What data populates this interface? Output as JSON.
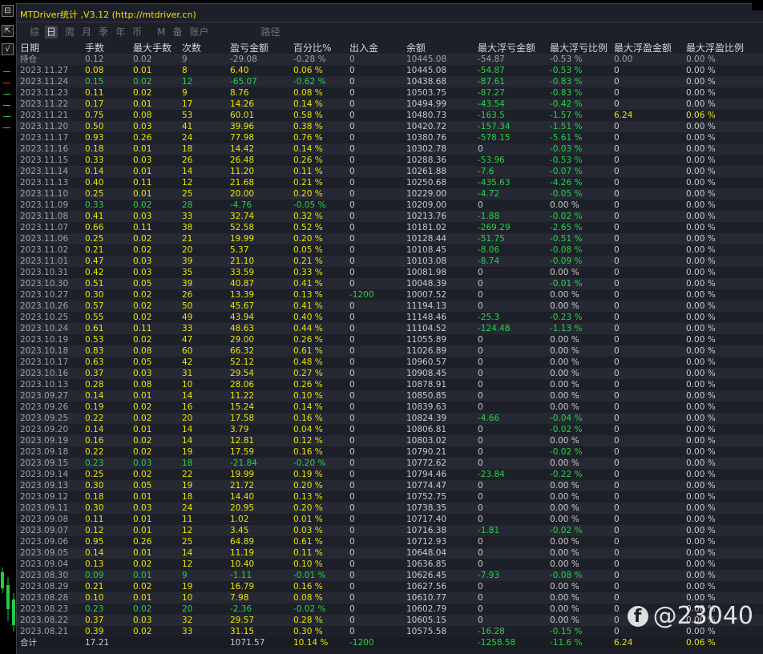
{
  "app": {
    "title": "MTDriver统计 ,V3.12 (http://mtdriver.cn)"
  },
  "tabs": [
    {
      "label": "综"
    },
    {
      "label": "日"
    },
    {
      "label": "周"
    },
    {
      "label": "月"
    },
    {
      "label": "季"
    },
    {
      "label": "年"
    },
    {
      "label": "币"
    },
    {
      "label": "M"
    },
    {
      "label": "备"
    },
    {
      "label": "账户"
    },
    {
      "label": "路径"
    }
  ],
  "active_tab": "日",
  "left_buttons": [
    {
      "label": "⊟"
    },
    {
      "label": "⇱"
    },
    {
      "label": "√"
    }
  ],
  "columns": [
    "日期",
    "手数",
    "最大手数",
    "次数",
    "盈亏金额",
    "百分比%",
    "出入金",
    "余额",
    "最大浮亏金额",
    "最大浮亏比例",
    "最大浮盈金额",
    "最大浮盈比例"
  ],
  "holding": {
    "date": "持仓",
    "lots": "0.12",
    "max_lots": "0.02",
    "count": "9",
    "pnl": "-29.08",
    "pct": "-0.28 %",
    "dep": "0",
    "bal": "10445.08",
    "max_dd": "-54.87",
    "max_dd_pct": "-0.53 %",
    "max_fp": "0.00",
    "max_fp_pct": "0.00 %"
  },
  "rows": [
    [
      "2023.11.27",
      "0.08",
      "0.01",
      "8",
      "6.40",
      "0.06 %",
      "0",
      "10445.08",
      "-54.87",
      "-0.53 %",
      "0",
      "0.00 %"
    ],
    [
      "2023.11.24",
      "0.15",
      "0.02",
      "12",
      "-65.07",
      "-0.62 %",
      "0",
      "10438.68",
      "-87.61",
      "-0.83 %",
      "0",
      "0.00 %"
    ],
    [
      "2023.11.23",
      "0.11",
      "0.02",
      "9",
      "8.76",
      "0.08 %",
      "0",
      "10503.75",
      "-87.27",
      "-0.83 %",
      "0",
      "0.00 %"
    ],
    [
      "2023.11.22",
      "0.17",
      "0.01",
      "17",
      "14.26",
      "0.14 %",
      "0",
      "10494.99",
      "-43.54",
      "-0.42 %",
      "0",
      "0.00 %"
    ],
    [
      "2023.11.21",
      "0.75",
      "0.08",
      "53",
      "60.01",
      "0.58 %",
      "0",
      "10480.73",
      "-163.5",
      "-1.57 %",
      "6.24",
      "0.06 %"
    ],
    [
      "2023.11.20",
      "0.50",
      "0.03",
      "41",
      "39.96",
      "0.38 %",
      "0",
      "10420.72",
      "-157.34",
      "-1.51 %",
      "0",
      "0.00 %"
    ],
    [
      "2023.11.17",
      "0.93",
      "0.26",
      "24",
      "77.98",
      "0.76 %",
      "0",
      "10380.76",
      "-578.15",
      "-5.61 %",
      "0",
      "0.00 %"
    ],
    [
      "2023.11.16",
      "0.18",
      "0.01",
      "18",
      "14.42",
      "0.14 %",
      "0",
      "10302.78",
      "0",
      "-0.03 %",
      "0",
      "0.00 %"
    ],
    [
      "2023.11.15",
      "0.33",
      "0.03",
      "26",
      "26.48",
      "0.26 %",
      "0",
      "10288.36",
      "-53.96",
      "-0.53 %",
      "0",
      "0.00 %"
    ],
    [
      "2023.11.14",
      "0.14",
      "0.01",
      "14",
      "11.20",
      "0.11 %",
      "0",
      "10261.88",
      "-7.6",
      "-0.07 %",
      "0",
      "0.00 %"
    ],
    [
      "2023.11.13",
      "0.40",
      "0.11",
      "12",
      "21.68",
      "0.21 %",
      "0",
      "10250.68",
      "-435.63",
      "-4.26 %",
      "0",
      "0.00 %"
    ],
    [
      "2023.11.10",
      "0.25",
      "0.01",
      "25",
      "20.00",
      "0.20 %",
      "0",
      "10229.00",
      "-4.72",
      "-0.05 %",
      "0",
      "0.00 %"
    ],
    [
      "2023.11.09",
      "0.33",
      "0.02",
      "28",
      "-4.76",
      "-0.05 %",
      "0",
      "10209.00",
      "0",
      "0.00 %",
      "0",
      "0.00 %"
    ],
    [
      "2023.11.08",
      "0.41",
      "0.03",
      "33",
      "32.74",
      "0.32 %",
      "0",
      "10213.76",
      "-1.88",
      "-0.02 %",
      "0",
      "0.00 %"
    ],
    [
      "2023.11.07",
      "0.66",
      "0.11",
      "38",
      "52.58",
      "0.52 %",
      "0",
      "10181.02",
      "-269.29",
      "-2.65 %",
      "0",
      "0.00 %"
    ],
    [
      "2023.11.06",
      "0.25",
      "0.02",
      "21",
      "19.99",
      "0.20 %",
      "0",
      "10128.44",
      "-51.75",
      "-0.51 %",
      "0",
      "0.00 %"
    ],
    [
      "2023.11.02",
      "0.21",
      "0.02",
      "20",
      "5.37",
      "0.05 %",
      "0",
      "10108.45",
      "-8.06",
      "-0.08 %",
      "0",
      "0.00 %"
    ],
    [
      "2023.11.01",
      "0.47",
      "0.03",
      "39",
      "21.10",
      "0.21 %",
      "0",
      "10103.08",
      "-8.74",
      "-0.09 %",
      "0",
      "0.00 %"
    ],
    [
      "2023.10.31",
      "0.42",
      "0.03",
      "35",
      "33.59",
      "0.33 %",
      "0",
      "10081.98",
      "0",
      "0.00 %",
      "0",
      "0.00 %"
    ],
    [
      "2023.10.30",
      "0.51",
      "0.05",
      "39",
      "40.87",
      "0.41 %",
      "0",
      "10048.39",
      "0",
      "-0.01 %",
      "0",
      "0.00 %"
    ],
    [
      "2023.10.27",
      "0.30",
      "0.02",
      "26",
      "13.39",
      "0.13 %",
      "-1200",
      "10007.52",
      "0",
      "0.00 %",
      "0",
      "0.00 %"
    ],
    [
      "2023.10.26",
      "0.57",
      "0.02",
      "50",
      "45.67",
      "0.41 %",
      "0",
      "11194.13",
      "0",
      "0.00 %",
      "0",
      "0.00 %"
    ],
    [
      "2023.10.25",
      "0.55",
      "0.02",
      "49",
      "43.94",
      "0.40 %",
      "0",
      "11148.46",
      "-25.3",
      "-0.23 %",
      "0",
      "0.00 %"
    ],
    [
      "2023.10.24",
      "0.61",
      "0.11",
      "33",
      "48.63",
      "0.44 %",
      "0",
      "11104.52",
      "-124.48",
      "-1.13 %",
      "0",
      "0.00 %"
    ],
    [
      "2023.10.19",
      "0.53",
      "0.02",
      "47",
      "29.00",
      "0.26 %",
      "0",
      "11055.89",
      "0",
      "0.00 %",
      "0",
      "0.00 %"
    ],
    [
      "2023.10.18",
      "0.83",
      "0.08",
      "60",
      "66.32",
      "0.61 %",
      "0",
      "11026.89",
      "0",
      "0.00 %",
      "0",
      "0.00 %"
    ],
    [
      "2023.10.17",
      "0.63",
      "0.05",
      "42",
      "52.12",
      "0.48 %",
      "0",
      "10960.57",
      "0",
      "0.00 %",
      "0",
      "0.00 %"
    ],
    [
      "2023.10.16",
      "0.37",
      "0.03",
      "31",
      "29.54",
      "0.27 %",
      "0",
      "10908.45",
      "0",
      "0.00 %",
      "0",
      "0.00 %"
    ],
    [
      "2023.10.13",
      "0.28",
      "0.08",
      "10",
      "28.06",
      "0.26 %",
      "0",
      "10878.91",
      "0",
      "0.00 %",
      "0",
      "0.00 %"
    ],
    [
      "2023.09.27",
      "0.14",
      "0.01",
      "14",
      "11.22",
      "0.10 %",
      "0",
      "10850.85",
      "0",
      "0.00 %",
      "0",
      "0.00 %"
    ],
    [
      "2023.09.26",
      "0.19",
      "0.02",
      "16",
      "15.24",
      "0.14 %",
      "0",
      "10839.63",
      "0",
      "0.00 %",
      "0",
      "0.00 %"
    ],
    [
      "2023.09.25",
      "0.22",
      "0.02",
      "20",
      "17.58",
      "0.16 %",
      "0",
      "10824.39",
      "-4.66",
      "-0.04 %",
      "0",
      "0.00 %"
    ],
    [
      "2023.09.20",
      "0.14",
      "0.01",
      "14",
      "3.79",
      "0.04 %",
      "0",
      "10806.81",
      "0",
      "-0.02 %",
      "0",
      "0.00 %"
    ],
    [
      "2023.09.19",
      "0.16",
      "0.02",
      "14",
      "12.81",
      "0.12 %",
      "0",
      "10803.02",
      "0",
      "0.00 %",
      "0",
      "0.00 %"
    ],
    [
      "2023.09.18",
      "0.22",
      "0.02",
      "19",
      "17.59",
      "0.16 %",
      "0",
      "10790.21",
      "0",
      "-0.02 %",
      "0",
      "0.00 %"
    ],
    [
      "2023.09.15",
      "0.23",
      "0.03",
      "18",
      "-21.84",
      "-0.20 %",
      "0",
      "10772.62",
      "0",
      "0.00 %",
      "0",
      "0.00 %"
    ],
    [
      "2023.09.14",
      "0.25",
      "0.02",
      "22",
      "19.99",
      "0.19 %",
      "0",
      "10794.46",
      "-23.84",
      "-0.22 %",
      "0",
      "0.00 %"
    ],
    [
      "2023.09.13",
      "0.30",
      "0.05",
      "19",
      "21.72",
      "0.20 %",
      "0",
      "10774.47",
      "0",
      "0.00 %",
      "0",
      "0.00 %"
    ],
    [
      "2023.09.12",
      "0.18",
      "0.01",
      "18",
      "14.40",
      "0.13 %",
      "0",
      "10752.75",
      "0",
      "0.00 %",
      "0",
      "0.00 %"
    ],
    [
      "2023.09.11",
      "0.30",
      "0.03",
      "24",
      "20.95",
      "0.20 %",
      "0",
      "10738.35",
      "0",
      "0.00 %",
      "0",
      "0.00 %"
    ],
    [
      "2023.09.08",
      "0.11",
      "0.01",
      "11",
      "1.02",
      "0.01 %",
      "0",
      "10717.40",
      "0",
      "0.00 %",
      "0",
      "0.00 %"
    ],
    [
      "2023.09.07",
      "0.12",
      "0.01",
      "12",
      "3.45",
      "0.03 %",
      "0",
      "10716.38",
      "-1.81",
      "-0.02 %",
      "0",
      "0.00 %"
    ],
    [
      "2023.09.06",
      "0.95",
      "0.26",
      "25",
      "64.89",
      "0.61 %",
      "0",
      "10712.93",
      "0",
      "0.00 %",
      "0",
      "0.00 %"
    ],
    [
      "2023.09.05",
      "0.14",
      "0.01",
      "14",
      "11.19",
      "0.11 %",
      "0",
      "10648.04",
      "0",
      "0.00 %",
      "0",
      "0.00 %"
    ],
    [
      "2023.09.04",
      "0.13",
      "0.02",
      "12",
      "10.40",
      "0.10 %",
      "0",
      "10636.85",
      "0",
      "0.00 %",
      "0",
      "0.00 %"
    ],
    [
      "2023.08.30",
      "0.09",
      "0.01",
      "9",
      "-1.11",
      "-0.01 %",
      "0",
      "10626.45",
      "-7.93",
      "-0.08 %",
      "0",
      "0.00 %"
    ],
    [
      "2023.08.29",
      "0.21",
      "0.02",
      "19",
      "16.79",
      "0.16 %",
      "0",
      "10627.56",
      "0",
      "0.00 %",
      "0",
      "0.00 %"
    ],
    [
      "2023.08.28",
      "0.10",
      "0.01",
      "10",
      "7.98",
      "0.08 %",
      "0",
      "10610.77",
      "0",
      "0.00 %",
      "0",
      "0.00 %"
    ],
    [
      "2023.08.23",
      "0.23",
      "0.02",
      "20",
      "-2.36",
      "-0.02 %",
      "0",
      "10602.79",
      "0",
      "0.00 %",
      "0",
      "0.00 %"
    ],
    [
      "2023.08.22",
      "0.37",
      "0.03",
      "32",
      "29.57",
      "0.28 %",
      "0",
      "10605.15",
      "0",
      "0.00 %",
      "0",
      "0.00 %"
    ],
    [
      "2023.08.21",
      "0.39",
      "0.02",
      "33",
      "31.15",
      "0.30 %",
      "0",
      "10575.58",
      "-16.28",
      "-0.15 %",
      "0",
      "0.00 %"
    ]
  ],
  "total": {
    "label": "合计",
    "lots": "17.21",
    "max_lots": "",
    "count": "",
    "pnl": "1071.57",
    "pct": "10.14 %",
    "dep": "-1200",
    "bal": "",
    "max_dd": "-1258.58",
    "max_dd_pct": "-11.6 %",
    "max_fp": "6.24",
    "max_fp_pct": "0.06 %"
  },
  "watermark": {
    "logo": "f",
    "text": "@23040"
  },
  "colors": {
    "positive": "#e6e600",
    "negative": "#27d14a",
    "neutral": "#c9c9c9",
    "panel": "#1e2029",
    "title": "#f0e000"
  }
}
